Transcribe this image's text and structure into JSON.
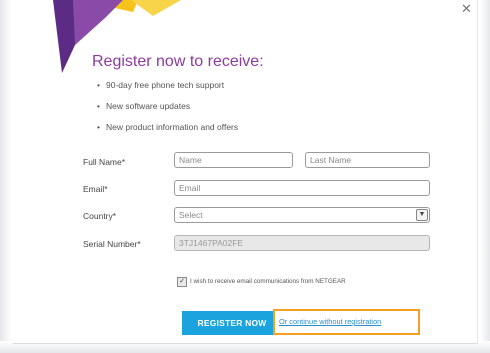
{
  "dialog": {
    "headline": "Register now to receive:",
    "benefits": [
      "90-day free phone tech support",
      "New software updates",
      "New product information and offers"
    ]
  },
  "form": {
    "full_name_label": "Full Name*",
    "first_name_placeholder": "Name",
    "last_name_placeholder": "Last Name",
    "email_label": "Email*",
    "email_placeholder": "Email",
    "country_label": "Country*",
    "country_value": "Select",
    "serial_label": "Serial Number*",
    "serial_value": "3TJ1467PA02FE",
    "optin_label": "I wish to receive email communications from NETGEAR",
    "optin_checked": true
  },
  "actions": {
    "register_label": "REGISTER NOW",
    "continue_label": "Or continue without registration"
  },
  "colors": {
    "headline": "#8e3aa0",
    "button": "#1aa3dc",
    "highlight": "#f5a023",
    "link": "#2a8fd0",
    "logo_purple": "#5b2b86",
    "logo_yellow": "#f6c31a"
  },
  "icons": {
    "close": "close-icon",
    "select_arrow": "chevron-down-icon",
    "checkbox": "checkmark-icon"
  }
}
